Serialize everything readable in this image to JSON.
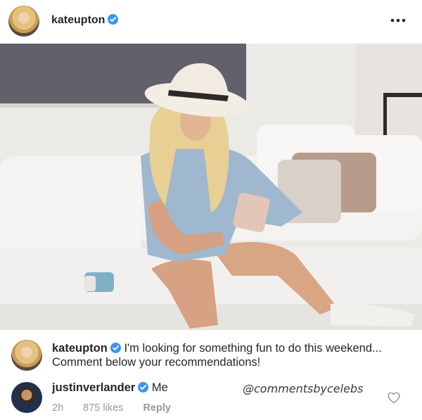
{
  "post": {
    "username": "kateupton",
    "verified": true,
    "more_icon": "ellipsis-icon"
  },
  "caption": {
    "username": "kateupton",
    "text": "I'm looking for something fun to do this weekend... Comment below your recommendations!"
  },
  "comment": {
    "username": "justinverlander",
    "text": "Me",
    "time": "2h",
    "likes": "875 likes",
    "reply_label": "Reply",
    "like_icon": "heart-icon"
  },
  "watermark": "@commentsbycelebs",
  "colors": {
    "verified_blue": "#3897f0",
    "text_dark": "#262626",
    "text_muted": "#999999"
  }
}
